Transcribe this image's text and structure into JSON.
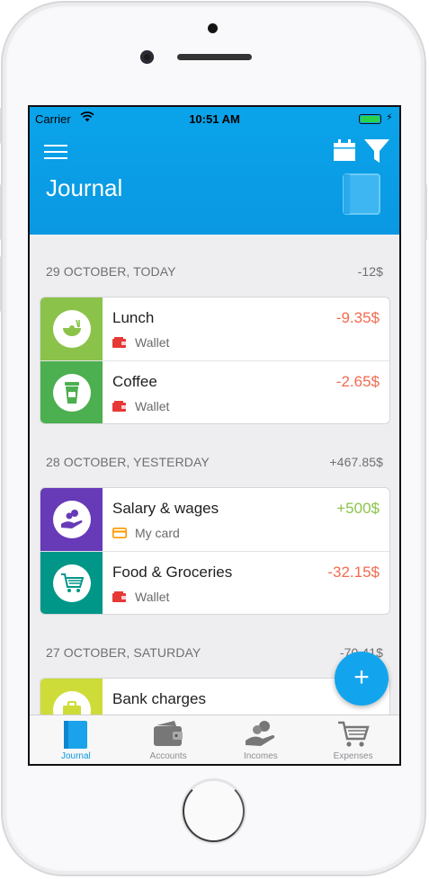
{
  "status_bar": {
    "carrier": "Carrier",
    "time": "10:51 AM"
  },
  "header": {
    "title": "Journal"
  },
  "days": [
    {
      "label": "29 OCTOBER, TODAY",
      "total": "-12$",
      "entries": [
        {
          "title": "Lunch",
          "account": "Wallet",
          "amount": "-9.35$",
          "category_color": "#8bc34a",
          "icon": "lunch-bowl-icon"
        },
        {
          "title": "Coffee",
          "account": "Wallet",
          "amount": "-2.65$",
          "category_color": "#4caf50",
          "icon": "coffee-cup-icon"
        }
      ]
    },
    {
      "label": "28 OCTOBER, YESTERDAY",
      "total": "+467.85$",
      "entries": [
        {
          "title": "Salary & wages",
          "account": "My card",
          "amount": "+500$",
          "category_color": "#673ab7",
          "icon": "salary-hand-icon"
        },
        {
          "title": "Food & Groceries",
          "account": "Wallet",
          "amount": "-32.15$",
          "category_color": "#009688",
          "icon": "grocery-cart-icon"
        }
      ]
    },
    {
      "label": "27 OCTOBER, SATURDAY",
      "total": "-70.41$",
      "entries": [
        {
          "title": "Bank charges",
          "account": "",
          "amount": "",
          "category_color": "#cddc39",
          "icon": "bank-charges-icon"
        }
      ]
    }
  ],
  "fab": {
    "label": "+"
  },
  "tabs": [
    {
      "label": "Journal",
      "icon": "journal-book-icon",
      "active": true
    },
    {
      "label": "Accounts",
      "icon": "wallet-icon",
      "active": false
    },
    {
      "label": "Incomes",
      "icon": "income-hand-icon",
      "active": false
    },
    {
      "label": "Expenses",
      "icon": "cart-icon",
      "active": false
    }
  ],
  "colors": {
    "primary": "#0a98e2",
    "negative": "#f26a4f",
    "positive": "#8bc34a"
  }
}
